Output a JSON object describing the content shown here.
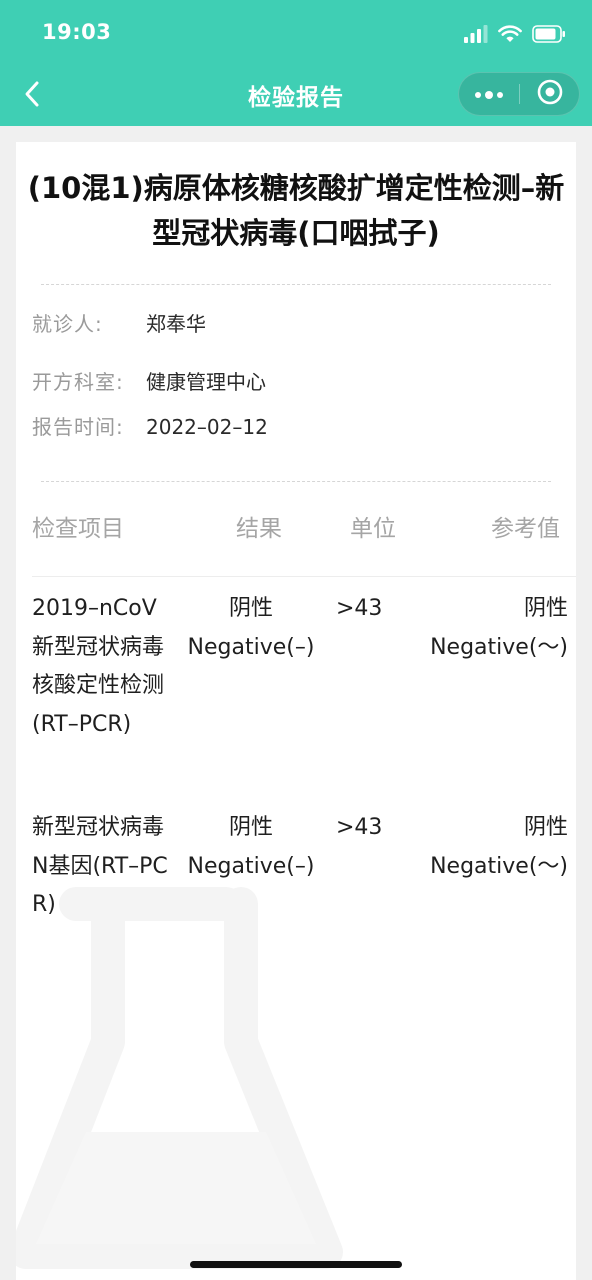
{
  "status_bar": {
    "time": "19:03"
  },
  "nav": {
    "title": "检验报告"
  },
  "report": {
    "title": "(10混1)病原体核糖核酸扩增定性检测–新型冠状病毒(口咽拭子)",
    "patient_label": "就诊人:",
    "patient_name": "郑奉华",
    "department_label": "开方科室:",
    "department": "健康管理中心",
    "date_label": "报告时间:",
    "date": "2022–02–12"
  },
  "table": {
    "headers": {
      "item": "检查项目",
      "result": "结果",
      "unit": "单位",
      "reference": "参考值"
    },
    "rows": [
      {
        "item": "2019–nCoV新型冠状病毒核酸定性检测(RT–PCR)",
        "result_cn": "阴性",
        "result_en": "Negative(–)",
        "unit": ">43",
        "ref_cn": "阴性",
        "ref_en": "Negative(～)"
      },
      {
        "item": "新型冠状病毒N基因(RT–PCR)",
        "result_cn": "阴性",
        "result_en": "Negative(–)",
        "unit": ">43",
        "ref_cn": "阴性",
        "ref_en": "Negative(～)"
      }
    ]
  },
  "colors": {
    "brand": "#3fcfb4",
    "page_background": "#f0f0f0",
    "card_background": "#ffffff",
    "muted_text": "#9a9a9a"
  },
  "icons": {
    "back": "chevron-left-icon",
    "more": "more-dots-icon",
    "close": "target-circle-icon",
    "signal": "signal-icon",
    "wifi": "wifi-icon",
    "battery": "battery-icon",
    "watermark": "flask-icon"
  }
}
